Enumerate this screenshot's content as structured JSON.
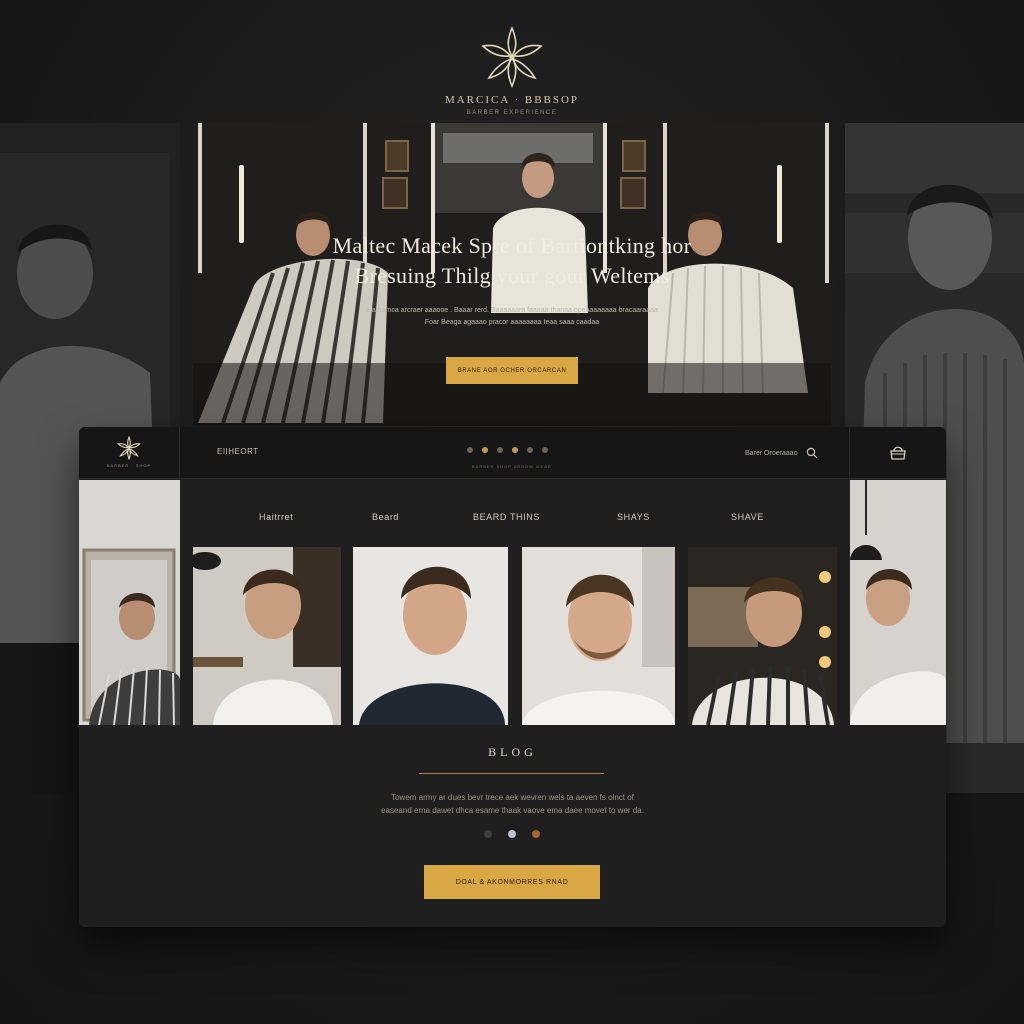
{
  "brand": {
    "name": "MARCICA · BBBSOP",
    "tagline": "BARBER EXPERIENCE"
  },
  "hero": {
    "title_line1": "Maltec Macek Spre of Bartiontking hor",
    "title_line2": "Bresuing Thilg your gour Weltems",
    "subtitle_line1": "a afaamca arcraer aaaooe . Baaar rerd. Baaaaaara faaaaa thanaa opeaaaaaaaa bracaaraaaa",
    "subtitle_line2": "Foar Beaga agaaao pracor aaaaaaaa teaa saaa caadaa",
    "cta_label": "BRANE AOR OCHER ORCARCAN"
  },
  "nav": {
    "logo_text": "BARBER · SHOP",
    "section_label": "EIIHEORT",
    "under_dots_text": "BARBER SHOP ARROW MEAR",
    "search_label": "Barer Oroeraaao"
  },
  "categories": [
    "Haitrret",
    "Beard",
    "BEARD THINS",
    "SHAYS",
    "SHAVE"
  ],
  "blog": {
    "title": "BLOG",
    "text_line1": "Towem army ar dues bevr trece aek wevren wels ta aeven fs olnct of",
    "text_line2": "easeand erna dawet dhca esame thaak vaove ema daee movet to wer da.",
    "cta_label": "DOAL & AKONMORRES RNAD"
  },
  "colors": {
    "accent_gold": "#d9a744",
    "panel_bg": "#1f1f1f",
    "page_bg": "#1b1b1b"
  },
  "icons": [
    "brand-flower-icon",
    "search-icon",
    "cart-icon"
  ]
}
